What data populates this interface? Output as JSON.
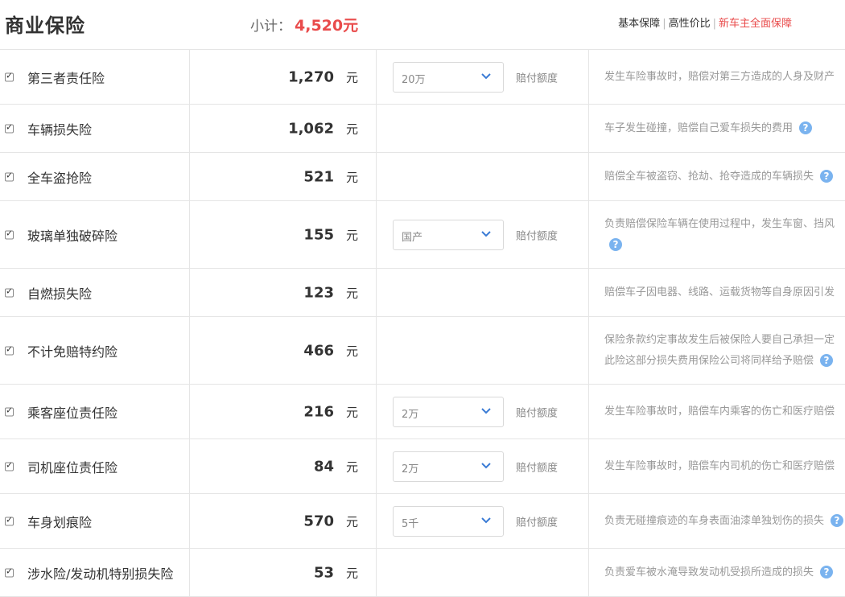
{
  "header": {
    "title": "商业保险",
    "subtotal_label": "小计：",
    "subtotal_value": "4,520元",
    "links": [
      "基本保障",
      "高性价比",
      "新车主全面保障"
    ]
  },
  "unit": "元",
  "coverage_label": "赔付额度",
  "rows": [
    {
      "name": "第三者责任险",
      "price": "1,270",
      "select": "20万",
      "desc": "发生车险事故时，赔偿对第三方造成的人身及财产",
      "help": false
    },
    {
      "name": "车辆损失险",
      "price": "1,062",
      "select": null,
      "desc": "车子发生碰撞，赔偿自己爱车损失的费用",
      "help": true
    },
    {
      "name": "全车盗抢险",
      "price": "521",
      "select": null,
      "desc": "赔偿全车被盗窃、抢劫、抢夺造成的车辆损失",
      "help": true
    },
    {
      "name": "玻璃单独破碎险",
      "price": "155",
      "select": "国产",
      "desc": "负责赔偿保险车辆在使用过程中，发生车窗、挡风",
      "desc2": "",
      "help2": true
    },
    {
      "name": "自燃损失险",
      "price": "123",
      "select": null,
      "desc": "赔偿车子因电器、线路、运载货物等自身原因引发",
      "help": false
    },
    {
      "name": "不计免赔特约险",
      "price": "466",
      "select": null,
      "desc": "保险条款约定事故发生后被保险人要自己承担一定",
      "desc2": "此险这部分损失费用保险公司将同样给予赔偿",
      "help2": true
    },
    {
      "name": "乘客座位责任险",
      "price": "216",
      "select": "2万",
      "desc": "发生车险事故时，赔偿车内乘客的伤亡和医疗赔偿",
      "help": false
    },
    {
      "name": "司机座位责任险",
      "price": "84",
      "select": "2万",
      "desc": "发生车险事故时，赔偿车内司机的伤亡和医疗赔偿",
      "help": false
    },
    {
      "name": "车身划痕险",
      "price": "570",
      "select": "5千",
      "desc": "负责无碰撞痕迹的车身表面油漆单独划伤的损失",
      "help": true
    },
    {
      "name": "涉水险/发动机特别损失险",
      "price": "53",
      "select": null,
      "desc": "负责爱车被水淹导致发动机受损所造成的损失",
      "help": true
    }
  ]
}
